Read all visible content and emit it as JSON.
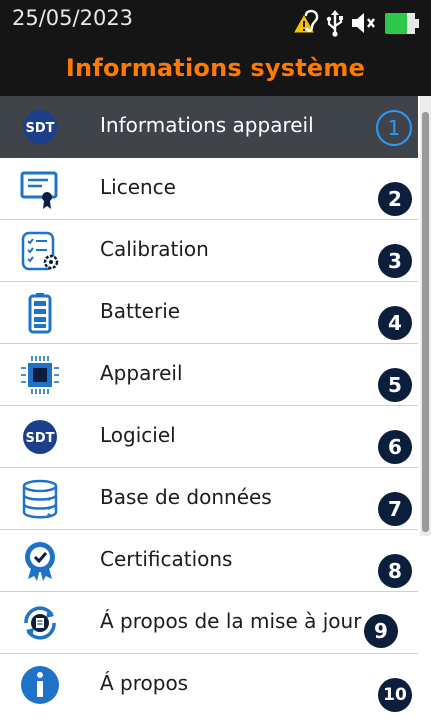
{
  "status": {
    "date": "25/05/2023",
    "icons": [
      "hearing-warning-icon",
      "usb-icon",
      "mute-icon",
      "battery-icon"
    ],
    "battery_color": "#2fc84a"
  },
  "header": {
    "title": "Informations système",
    "accent": "#ff7a00"
  },
  "menu": {
    "items": [
      {
        "label": "Informations appareil",
        "number": "1",
        "icon": "sdt-logo-icon"
      },
      {
        "label": "Licence",
        "number": "2",
        "icon": "licence-certificate-icon"
      },
      {
        "label": "Calibration",
        "number": "3",
        "icon": "calibration-checklist-icon"
      },
      {
        "label": "Batterie",
        "number": "4",
        "icon": "battery-full-icon"
      },
      {
        "label": "Appareil",
        "number": "5",
        "icon": "chip-icon"
      },
      {
        "label": "Logiciel",
        "number": "6",
        "icon": "sdt-logo-icon"
      },
      {
        "label": "Base de données",
        "number": "7",
        "icon": "database-icon"
      },
      {
        "label": "Certifications",
        "number": "8",
        "icon": "certification-seal-icon"
      },
      {
        "label": "Á propos de la mise à jour",
        "number": "9",
        "icon": "update-document-icon"
      },
      {
        "label": "Á propos",
        "number": "10",
        "icon": "info-icon"
      }
    ],
    "sdt_text": "SDT",
    "selected_index": 0
  }
}
